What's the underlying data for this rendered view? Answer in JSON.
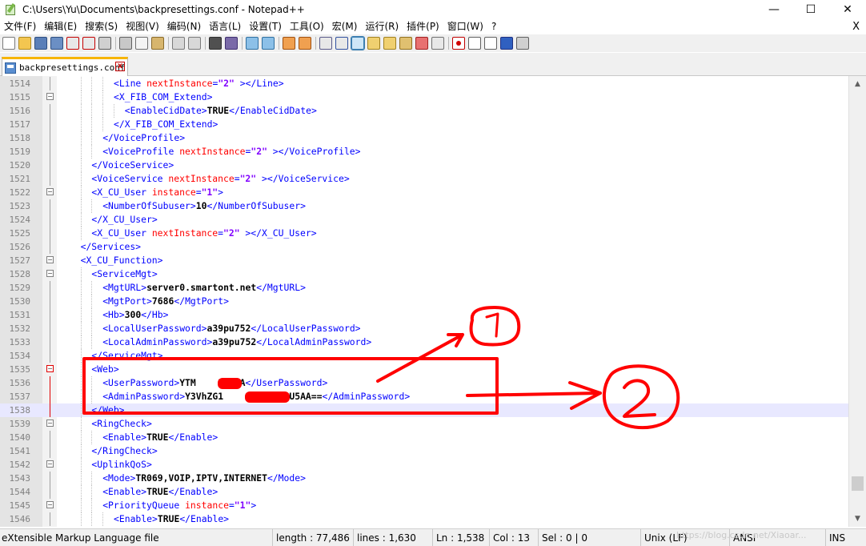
{
  "window": {
    "title": "C:\\Users\\Yu\\Documents\\backpresettings.conf - Notepad++",
    "min_symbol": "—",
    "max_symbol": "☐",
    "close_symbol": "✕"
  },
  "menu": {
    "items": [
      "文件(F)",
      "编辑(E)",
      "搜索(S)",
      "视图(V)",
      "编码(N)",
      "语言(L)",
      "设置(T)",
      "工具(O)",
      "宏(M)",
      "运行(R)",
      "插件(P)",
      "窗口(W)",
      "?"
    ],
    "close_symbol": "X"
  },
  "toolbar": {
    "icons": [
      {
        "name": "new-file-icon",
        "color": "#ffffff",
        "border": "#7a7a7a"
      },
      {
        "name": "open-file-icon",
        "color": "#f3c650",
        "border": "#b08a20"
      },
      {
        "name": "save-icon",
        "color": "#5a7fb8",
        "border": "#2f4f80"
      },
      {
        "name": "save-all-icon",
        "color": "#6b8fc4",
        "border": "#2f4f80"
      },
      {
        "name": "close-file-icon",
        "color": "#e8e8e8",
        "border": "#c40000"
      },
      {
        "name": "close-all-icon",
        "color": "#e8e8e8",
        "border": "#c40000"
      },
      {
        "name": "print-icon",
        "color": "#d0d0d0",
        "border": "#5a5a5a"
      },
      {
        "sep": true
      },
      {
        "name": "cut-icon",
        "color": "#c8c8c8",
        "border": "#606060"
      },
      {
        "name": "copy-icon",
        "color": "#f4f4f4",
        "border": "#707070"
      },
      {
        "name": "paste-icon",
        "color": "#d7b56d",
        "border": "#8a6a2a"
      },
      {
        "sep": true
      },
      {
        "name": "undo-icon",
        "color": "#d8d8d8",
        "border": "#7a7a7a"
      },
      {
        "name": "redo-icon",
        "color": "#d8d8d8",
        "border": "#7a7a7a"
      },
      {
        "sep": true
      },
      {
        "name": "find-icon",
        "color": "#505050",
        "border": "#303030"
      },
      {
        "name": "replace-icon",
        "color": "#7a6aa8",
        "border": "#403070"
      },
      {
        "sep": true
      },
      {
        "name": "zoom-in-icon",
        "color": "#8cc0e8",
        "border": "#2f6fa0"
      },
      {
        "name": "zoom-out-icon",
        "color": "#8cc0e8",
        "border": "#2f6fa0"
      },
      {
        "sep": true
      },
      {
        "name": "sync-vertical-icon",
        "color": "#f0a050",
        "border": "#a05010"
      },
      {
        "name": "sync-horizontal-icon",
        "color": "#f0a050",
        "border": "#a05010"
      },
      {
        "sep": true
      },
      {
        "name": "word-wrap-icon",
        "color": "#e8e8e8",
        "border": "#5a5a8a"
      },
      {
        "name": "show-all-chars-icon",
        "color": "#e8e8e8",
        "border": "#3050a0"
      },
      {
        "name": "indent-guide-icon",
        "color": "#cde6f7",
        "border": "#3c7fb1",
        "selected": true
      },
      {
        "name": "user-lang-icon",
        "color": "#f0d070",
        "border": "#a08020"
      },
      {
        "name": "doc-map-icon",
        "color": "#f0d070",
        "border": "#a08020"
      },
      {
        "name": "function-list-icon",
        "color": "#e0c070",
        "border": "#907020"
      },
      {
        "name": "folder-workspace-icon",
        "color": "#e87070",
        "border": "#a02020"
      },
      {
        "name": "monitoring-icon",
        "color": "#e8e8e8",
        "border": "#707070"
      },
      {
        "sep": true
      },
      {
        "name": "record-macro-icon",
        "color": "#ffffff",
        "border": "#c00000",
        "dot": "#d00000"
      },
      {
        "name": "stop-record-icon",
        "color": "#ffffff",
        "border": "#606060"
      },
      {
        "name": "playback-icon",
        "color": "#ffffff",
        "border": "#606060"
      },
      {
        "name": "run-multiple-icon",
        "color": "#3060c0",
        "border": "#203080"
      },
      {
        "name": "save-macro-icon",
        "color": "#d0d0d0",
        "border": "#606060"
      }
    ]
  },
  "tab": {
    "label": "backpresettings.conf",
    "close_symbol": "x"
  },
  "editor": {
    "current_line": "1538",
    "lines": [
      {
        "n": "1514",
        "indent": 10,
        "fold": "",
        "parts": [
          [
            "tag",
            "<Line "
          ],
          [
            "attr",
            "nextInstance"
          ],
          [
            "tag",
            "="
          ],
          [
            "val",
            "\"2\""
          ],
          [
            "tag",
            " ></Line>"
          ]
        ]
      },
      {
        "n": "1515",
        "indent": 10,
        "fold": "minus",
        "parts": [
          [
            "tag",
            "<X_FIB_COM_Extend>"
          ]
        ]
      },
      {
        "n": "1516",
        "indent": 12,
        "fold": "",
        "parts": [
          [
            "tag",
            "<EnableCidDate>"
          ],
          [
            "txt",
            "TRUE"
          ],
          [
            "tag",
            "</EnableCidDate>"
          ]
        ]
      },
      {
        "n": "1517",
        "indent": 10,
        "fold": "",
        "parts": [
          [
            "tag",
            "</X_FIB_COM_Extend>"
          ]
        ]
      },
      {
        "n": "1518",
        "indent": 8,
        "fold": "",
        "parts": [
          [
            "tag",
            "</VoiceProfile>"
          ]
        ]
      },
      {
        "n": "1519",
        "indent": 8,
        "fold": "",
        "parts": [
          [
            "tag",
            "<VoiceProfile "
          ],
          [
            "attr",
            "nextInstance"
          ],
          [
            "tag",
            "="
          ],
          [
            "val",
            "\"2\""
          ],
          [
            "tag",
            " ></VoiceProfile>"
          ]
        ]
      },
      {
        "n": "1520",
        "indent": 6,
        "fold": "",
        "parts": [
          [
            "tag",
            "</VoiceService>"
          ]
        ]
      },
      {
        "n": "1521",
        "indent": 6,
        "fold": "",
        "parts": [
          [
            "tag",
            "<VoiceService "
          ],
          [
            "attr",
            "nextInstance"
          ],
          [
            "tag",
            "="
          ],
          [
            "val",
            "\"2\""
          ],
          [
            "tag",
            " ></VoiceService>"
          ]
        ]
      },
      {
        "n": "1522",
        "indent": 6,
        "fold": "minus",
        "parts": [
          [
            "tag",
            "<X_CU_User "
          ],
          [
            "attr",
            "instance"
          ],
          [
            "tag",
            "="
          ],
          [
            "val",
            "\"1\""
          ],
          [
            "tag",
            ">"
          ]
        ]
      },
      {
        "n": "1523",
        "indent": 8,
        "fold": "",
        "parts": [
          [
            "tag",
            "<NumberOfSubuser>"
          ],
          [
            "txt",
            "10"
          ],
          [
            "tag",
            "</NumberOfSubuser>"
          ]
        ]
      },
      {
        "n": "1524",
        "indent": 6,
        "fold": "",
        "parts": [
          [
            "tag",
            "</X_CU_User>"
          ]
        ]
      },
      {
        "n": "1525",
        "indent": 6,
        "fold": "",
        "parts": [
          [
            "tag",
            "<X_CU_User "
          ],
          [
            "attr",
            "nextInstance"
          ],
          [
            "tag",
            "="
          ],
          [
            "val",
            "\"2\""
          ],
          [
            "tag",
            " ></X_CU_User>"
          ]
        ]
      },
      {
        "n": "1526",
        "indent": 4,
        "fold": "",
        "parts": [
          [
            "tag",
            "</Services>"
          ]
        ]
      },
      {
        "n": "1527",
        "indent": 4,
        "fold": "minus",
        "parts": [
          [
            "tag",
            "<X_CU_Function>"
          ]
        ]
      },
      {
        "n": "1528",
        "indent": 6,
        "fold": "minus",
        "parts": [
          [
            "tag",
            "<ServiceMgt>"
          ]
        ]
      },
      {
        "n": "1529",
        "indent": 8,
        "fold": "",
        "parts": [
          [
            "tag",
            "<MgtURL>"
          ],
          [
            "txt",
            "server0.smartont.net"
          ],
          [
            "tag",
            "</MgtURL>"
          ]
        ]
      },
      {
        "n": "1530",
        "indent": 8,
        "fold": "",
        "parts": [
          [
            "tag",
            "<MgtPort>"
          ],
          [
            "txt",
            "7686"
          ],
          [
            "tag",
            "</MgtPort>"
          ]
        ]
      },
      {
        "n": "1531",
        "indent": 8,
        "fold": "",
        "parts": [
          [
            "tag",
            "<Hb>"
          ],
          [
            "txt",
            "300"
          ],
          [
            "tag",
            "</Hb>"
          ]
        ]
      },
      {
        "n": "1532",
        "indent": 8,
        "fold": "",
        "parts": [
          [
            "tag",
            "<LocalUserPassword>"
          ],
          [
            "txt",
            "a39pu752"
          ],
          [
            "tag",
            "</LocalUserPassword>"
          ]
        ]
      },
      {
        "n": "1533",
        "indent": 8,
        "fold": "",
        "parts": [
          [
            "tag",
            "<LocalAdminPassword>"
          ],
          [
            "txt",
            "a39pu752"
          ],
          [
            "tag",
            "</LocalAdminPassword>"
          ]
        ]
      },
      {
        "n": "1534",
        "indent": 6,
        "fold": "",
        "parts": [
          [
            "tag",
            "</ServiceMgt>"
          ]
        ]
      },
      {
        "n": "1535",
        "indent": 6,
        "fold": "minus-red",
        "parts": [
          [
            "tag",
            "<Web>"
          ]
        ]
      },
      {
        "n": "1536",
        "indent": 8,
        "fold": "",
        "parts": [
          [
            "tag",
            "<UserPassword>"
          ],
          [
            "txt",
            "YTM    3NTIA"
          ],
          [
            "tag",
            "</UserPassword>"
          ]
        ]
      },
      {
        "n": "1537",
        "indent": 8,
        "fold": "",
        "parts": [
          [
            "tag",
            "<AdminPassword>"
          ],
          [
            "txt",
            "Y3VhZG1       jExMDU5AA=="
          ],
          [
            "tag",
            "</AdminPassword>"
          ]
        ]
      },
      {
        "n": "1538",
        "indent": 6,
        "fold": "",
        "parts": [
          [
            "tag",
            "</Web>"
          ]
        ]
      },
      {
        "n": "1539",
        "indent": 6,
        "fold": "minus",
        "parts": [
          [
            "tag",
            "<RingCheck>"
          ]
        ]
      },
      {
        "n": "1540",
        "indent": 8,
        "fold": "",
        "parts": [
          [
            "tag",
            "<Enable>"
          ],
          [
            "txt",
            "TRUE"
          ],
          [
            "tag",
            "</Enable>"
          ]
        ]
      },
      {
        "n": "1541",
        "indent": 6,
        "fold": "",
        "parts": [
          [
            "tag",
            "</RingCheck>"
          ]
        ]
      },
      {
        "n": "1542",
        "indent": 6,
        "fold": "minus",
        "parts": [
          [
            "tag",
            "<UplinkQoS>"
          ]
        ]
      },
      {
        "n": "1543",
        "indent": 8,
        "fold": "",
        "parts": [
          [
            "tag",
            "<Mode>"
          ],
          [
            "txt",
            "TR069,VOIP,IPTV,INTERNET"
          ],
          [
            "tag",
            "</Mode>"
          ]
        ]
      },
      {
        "n": "1544",
        "indent": 8,
        "fold": "",
        "parts": [
          [
            "tag",
            "<Enable>"
          ],
          [
            "txt",
            "TRUE"
          ],
          [
            "tag",
            "</Enable>"
          ]
        ]
      },
      {
        "n": "1545",
        "indent": 8,
        "fold": "minus",
        "parts": [
          [
            "tag",
            "<PriorityQueue "
          ],
          [
            "attr",
            "instance"
          ],
          [
            "tag",
            "="
          ],
          [
            "val",
            "\"1\""
          ],
          [
            "tag",
            ">"
          ]
        ]
      },
      {
        "n": "1546",
        "indent": 10,
        "fold": "",
        "parts": [
          [
            "tag",
            "<Enable>"
          ],
          [
            "txt",
            "TRUE"
          ],
          [
            "tag",
            "</Enable>"
          ]
        ]
      }
    ]
  },
  "status": {
    "file_type": "eXtensible Markup Language file",
    "length": "length : 77,486",
    "lines": "lines : 1,630",
    "ln": "Ln : 1,538",
    "col": "Col : 13",
    "sel": "Sel : 0 | 0",
    "eol": "Unix (LF)",
    "encoding": "ANSI",
    "mode": "INS"
  },
  "annotations": {
    "color": "#ff0000",
    "label_1": "①",
    "label_2": "②"
  },
  "watermark": "https://blog.csdn.net/Xiaoar..."
}
